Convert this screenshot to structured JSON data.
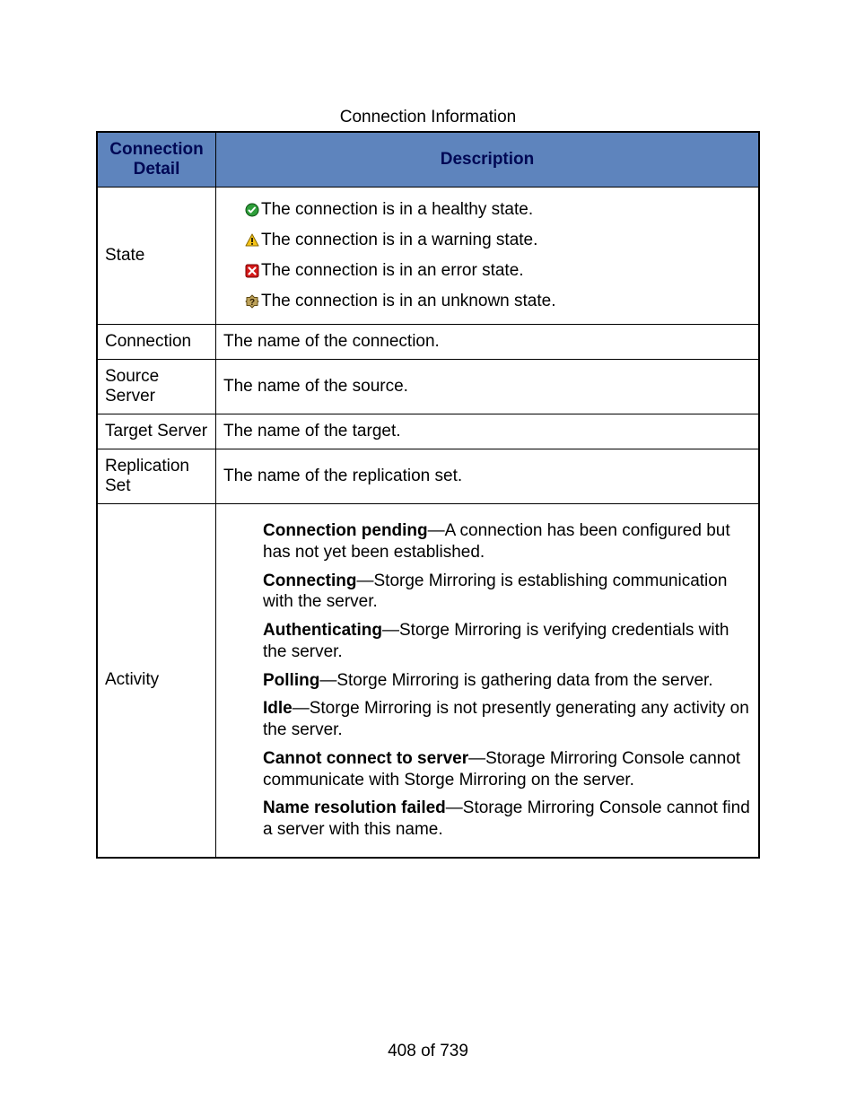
{
  "caption": "Connection Information",
  "headers": {
    "detail": "Connection Detail",
    "description": "Description"
  },
  "rows": {
    "state": {
      "label": "State",
      "items": [
        {
          "icon": "healthy",
          "text": "The connection is in a healthy state."
        },
        {
          "icon": "warning",
          "text": "The connection is in a warning state."
        },
        {
          "icon": "error",
          "text": "The connection is in an error state."
        },
        {
          "icon": "unknown",
          "text": "The connection is in an unknown state."
        }
      ]
    },
    "connection": {
      "label": "Connection",
      "desc": "The name of the connection."
    },
    "source_server": {
      "label": "Source Server",
      "desc": "The name of the source."
    },
    "target_server": {
      "label": "Target Server",
      "desc": "The name of the target."
    },
    "replication_set": {
      "label": "Replication Set",
      "desc": "The name of the replication set."
    },
    "activity": {
      "label": "Activity",
      "items": [
        {
          "term": "Connection pending",
          "desc": "A connection has been configured but has not yet been established."
        },
        {
          "term": "Connecting",
          "desc": "Storge Mirroring is establishing communication with the server."
        },
        {
          "term": "Authenticating",
          "desc": "Storge Mirroring is verifying credentials with the server."
        },
        {
          "term": "Polling",
          "desc": "Storge Mirroring is gathering data from the server."
        },
        {
          "term": "Idle",
          "desc": "Storge Mirroring is not presently generating any activity on the server."
        },
        {
          "term": "Cannot connect to server",
          "desc": "Storage Mirroring Console cannot communicate with Storge Mirroring on the server."
        },
        {
          "term": "Name resolution failed",
          "desc": "Storage Mirroring Console cannot find a server with this name."
        }
      ]
    }
  },
  "pager": "408 of 739"
}
